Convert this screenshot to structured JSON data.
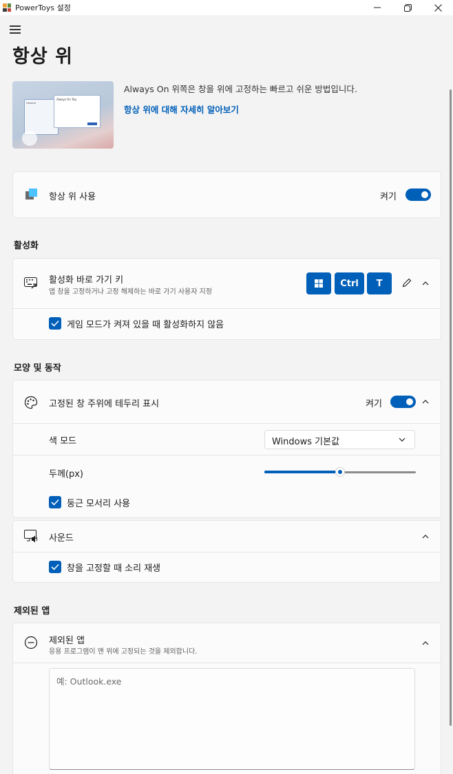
{
  "window": {
    "title": "PowerToys 설정"
  },
  "page": {
    "title": "항상 위",
    "description": "Always On 위쪽은 창을 위에 고정하는 빠르고 쉬운 방법입니다.",
    "learn_more": "항상 위에 대해 자세히 알아보기",
    "hero_thumb": {
      "window_title": "Always On Top",
      "sidebar_item": "General"
    }
  },
  "enable": {
    "label": "항상 위 사용",
    "state": "켜기"
  },
  "activation": {
    "section_title": "활성화",
    "shortcut_label": "활성화 바로 가기 키",
    "shortcut_desc": "앱 창을 고정하거나 고정 해제하는 바로 가기 사용자 지정",
    "keys": [
      "⊞",
      "Ctrl",
      "T"
    ],
    "game_mode_label": "게임 모드가 켜져 있을 때 활성화하지 않음"
  },
  "appearance": {
    "section_title": "모양 및 동작",
    "border_label": "고정된 창 주위에 테두리 표시",
    "border_state": "켜기",
    "color_mode_label": "색 모드",
    "color_mode_value": "Windows 기본값",
    "thickness_label": "두께(px)",
    "thickness_fraction": 0.5,
    "rounded_label": "둥근 모서리 사용",
    "sound_label": "사운드",
    "sound_play_label": "창을 고정할 때 소리 재생"
  },
  "excluded": {
    "section_title": "제외된 앱",
    "label": "제외된 앱",
    "desc": "응용 프로그램이 맨 위에 고정되는 것을 제외합니다.",
    "placeholder": "예: Outlook.exe"
  },
  "colors": {
    "accent": "#005fb8"
  }
}
